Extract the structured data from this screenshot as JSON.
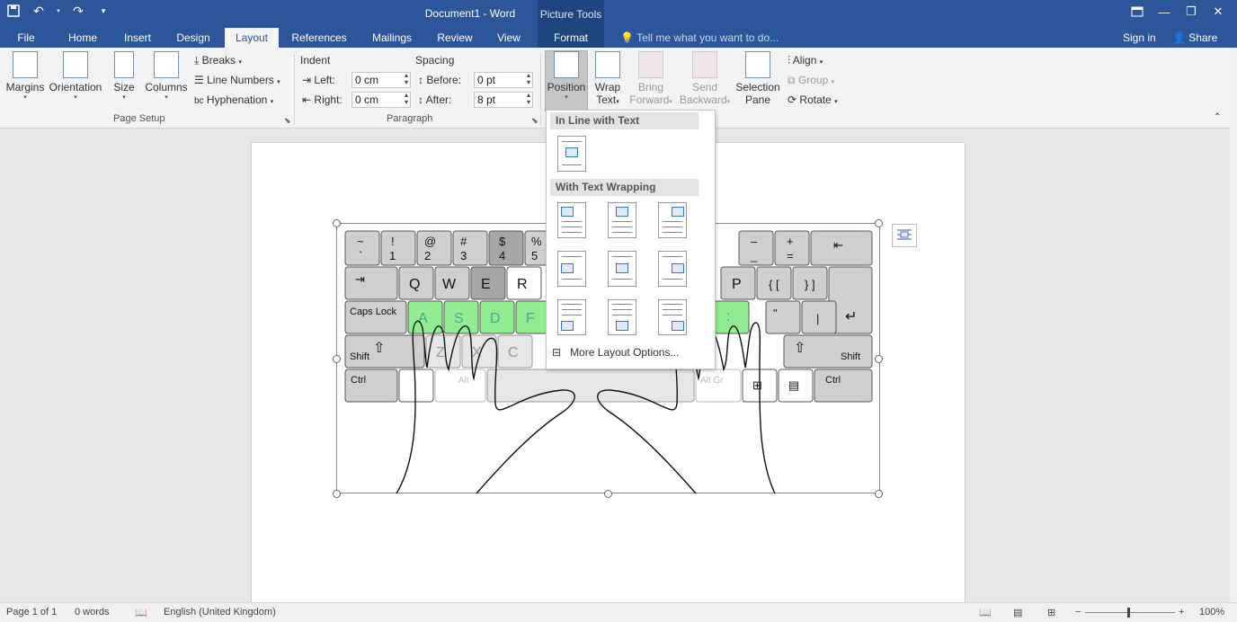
{
  "titlebar": {
    "doc_title": "Document1 - Word",
    "picture_tools": "Picture Tools"
  },
  "tabs": [
    {
      "label": "File"
    },
    {
      "label": "Home"
    },
    {
      "label": "Insert"
    },
    {
      "label": "Design"
    },
    {
      "label": "Layout"
    },
    {
      "label": "References"
    },
    {
      "label": "Mailings"
    },
    {
      "label": "Review"
    },
    {
      "label": "View"
    },
    {
      "label": "Format"
    }
  ],
  "tell_me": "Tell me what you want to do...",
  "account": {
    "signin": "Sign in",
    "share": "Share"
  },
  "ribbon": {
    "page_setup": {
      "margins": "Margins",
      "orientation": "Orientation",
      "size": "Size",
      "columns": "Columns",
      "breaks": "Breaks",
      "line_numbers": "Line Numbers",
      "hyphenation": "Hyphenation",
      "group": "Page Setup"
    },
    "paragraph": {
      "indent": "Indent",
      "spacing": "Spacing",
      "left_label": "Left:",
      "left_value": "0 cm",
      "right_label": "Right:",
      "right_value": "0 cm",
      "before_label": "Before:",
      "before_value": "0 pt",
      "after_label": "After:",
      "after_value": "8 pt",
      "group": "Paragraph"
    },
    "arrange": {
      "position": "Position",
      "wrap_text_1": "Wrap",
      "wrap_text_2": "Text",
      "bring_forward_1": "Bring",
      "bring_forward_2": "Forward",
      "send_backward_1": "Send",
      "send_backward_2": "Backward",
      "selection_pane_1": "Selection",
      "selection_pane_2": "Pane",
      "align": "Align",
      "group": "Group",
      "rotate": "Rotate"
    }
  },
  "dropdown": {
    "inline_header": "In Line with Text",
    "wrapping_header": "With Text Wrapping",
    "more": "More Layout Options..."
  },
  "status": {
    "page": "Page 1 of 1",
    "words": "0 words",
    "language": "English (United Kingdom)",
    "zoom": "100%"
  },
  "keyboard": {
    "row1": [
      {
        "top": "~",
        "bot": "`"
      },
      {
        "top": "!",
        "bot": "1"
      },
      {
        "top": "@",
        "bot": "2"
      },
      {
        "top": "#",
        "bot": "3"
      },
      {
        "top": "$",
        "bot": "4"
      },
      {
        "top": "%",
        "bot": "5"
      }
    ],
    "row1_right": [
      {
        "top": "–",
        "bot": "_"
      },
      {
        "top": "+",
        "bot": "="
      }
    ],
    "row2": [
      "Q",
      "W",
      "E",
      "R"
    ],
    "row2_right": [
      "P",
      "{ [",
      "} ]"
    ],
    "home_row": [
      "A",
      "S",
      "D",
      "F"
    ],
    "caps": "Caps Lock",
    "shift": "Shift",
    "ctrl": "Ctrl",
    "alt": "Alt",
    "altgr": "Alt Gr",
    "bottom_left": [
      "Z",
      "X",
      "C"
    ],
    "colon": ":"
  },
  "colors": {
    "accent": "#2b579a",
    "home_row": "#90ee90",
    "key": "#cfcfcf"
  }
}
